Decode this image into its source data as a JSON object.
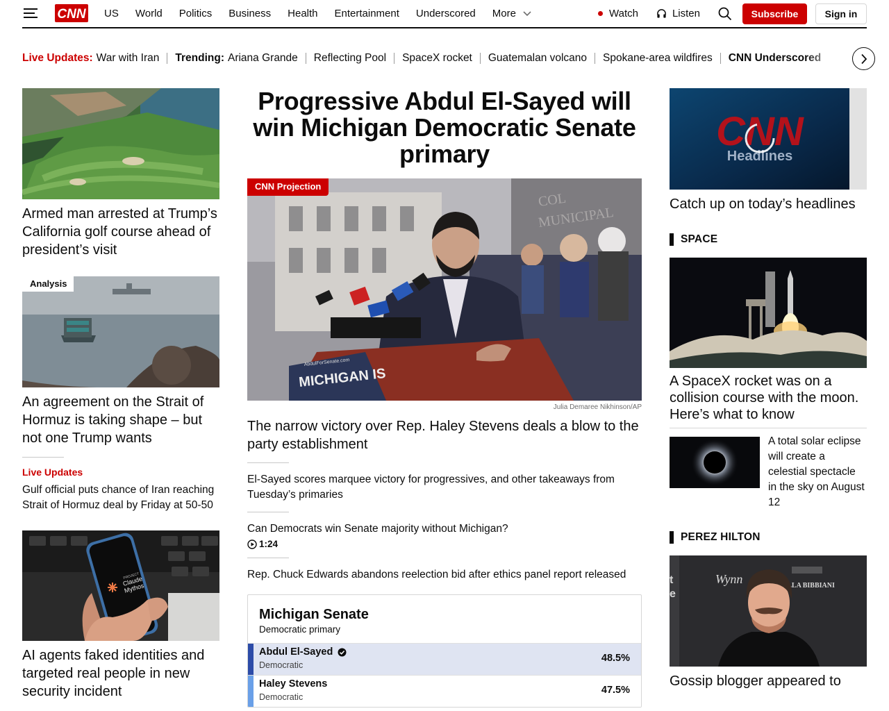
{
  "header": {
    "nav": [
      "US",
      "World",
      "Politics",
      "Business",
      "Health",
      "Entertainment",
      "Underscored"
    ],
    "more_label": "More",
    "watch_label": "Watch",
    "listen_label": "Listen",
    "subscribe_label": "Subscribe",
    "signin_label": "Sign in",
    "brand_color": "#cc0000"
  },
  "trending": {
    "live_label": "Live Updates:",
    "live_text": "War with Iran",
    "trending_label": "Trending:",
    "items": [
      "Ariana Grande",
      "Reflecting Pool",
      "SpaceX rocket",
      "Guatemalan volcano",
      "Spokane-area wildfires"
    ],
    "last_label": "CNN Underscored"
  },
  "left": {
    "story1": {
      "headline": "Armed man arrested at Trump’s California golf course ahead of president’s visit",
      "image_icon": "golf-course-aerial"
    },
    "story2": {
      "tag": "Analysis",
      "headline": "An agreement on the Strait of Hormuz is taking shape – but not one Trump wants",
      "image_icon": "ships-at-sea"
    },
    "live": {
      "label": "Live Updates",
      "text": "Gulf official puts chance of Iran reaching Strait of Hormuz deal by Friday at 50-50"
    },
    "story3": {
      "headline": "AI agents faked identities and targeted real people in new security incident",
      "phone_text": "Claude Mythos",
      "phone_small": "PROJECT",
      "image_icon": "phone-in-hand"
    }
  },
  "center": {
    "title": "Progressive Abdul El-Sayed will win Michigan Democratic Senate primary",
    "tag": "CNN Projection",
    "credit": "Julia Demaree Nikhinson/AP",
    "podium_text": "MICHIGAN IS",
    "podium_url": "AbdulForSenate.com",
    "sub_headline": "The narrow victory over Rep. Haley Stevens deals a blow to the party establishment",
    "links": [
      "El-Sayed scores marquee victory for progressives, and other takeaways from Tuesday’s primaries",
      "Can Democrats win Senate majority without Michigan?",
      "Rep. Chuck Edwards abandons reelection bid after ethics panel report released"
    ],
    "video_duration": "1:24",
    "race": {
      "title": "Michigan Senate",
      "subtitle": "Democratic primary",
      "candidates": [
        {
          "name": "Abdul El-Sayed",
          "party": "Democratic",
          "pct": "48.5%",
          "winner": true,
          "bar_color": "#2c4ba8",
          "bg": "#dfe4f2"
        },
        {
          "name": "Haley Stevens",
          "party": "Democratic",
          "pct": "47.5%",
          "winner": false,
          "bar_color": "#6aa0e8",
          "bg": "#ffffff"
        }
      ]
    }
  },
  "right": {
    "video": {
      "logo_text": "CNN",
      "logo_sub": "Headlines",
      "headline": "Catch up on today’s headlines"
    },
    "space": {
      "section": "SPACE",
      "headline": "A SpaceX rocket was on a collision course with the moon. Here’s what to know",
      "small_headline": "A total solar eclipse will create a celestial spectacle in the sky on August 12"
    },
    "perez": {
      "section": "PEREZ HILTON",
      "headline": "Gossip blogger appeared to",
      "backdrop_text1": "Wynn",
      "backdrop_text2": "VILLA BIBBIANI"
    }
  }
}
